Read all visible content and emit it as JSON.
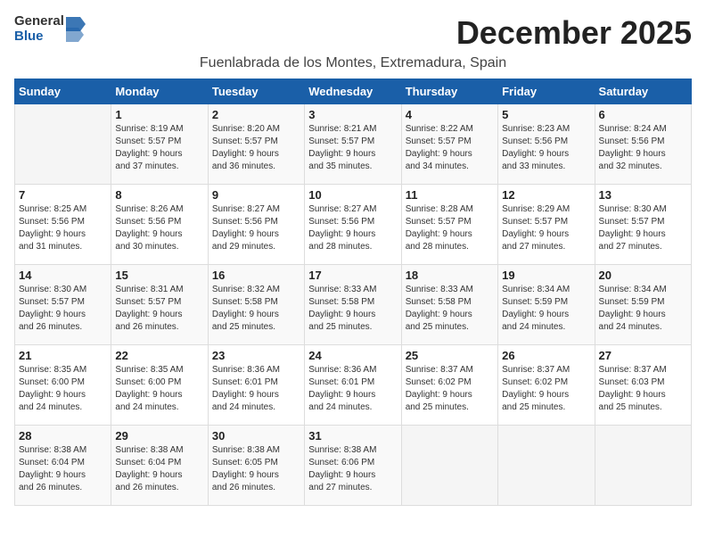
{
  "header": {
    "logo_general": "General",
    "logo_blue": "Blue",
    "month": "December 2025",
    "location": "Fuenlabrada de los Montes, Extremadura, Spain"
  },
  "weekdays": [
    "Sunday",
    "Monday",
    "Tuesday",
    "Wednesday",
    "Thursday",
    "Friday",
    "Saturday"
  ],
  "weeks": [
    [
      {
        "day": "",
        "info": ""
      },
      {
        "day": "1",
        "info": "Sunrise: 8:19 AM\nSunset: 5:57 PM\nDaylight: 9 hours\nand 37 minutes."
      },
      {
        "day": "2",
        "info": "Sunrise: 8:20 AM\nSunset: 5:57 PM\nDaylight: 9 hours\nand 36 minutes."
      },
      {
        "day": "3",
        "info": "Sunrise: 8:21 AM\nSunset: 5:57 PM\nDaylight: 9 hours\nand 35 minutes."
      },
      {
        "day": "4",
        "info": "Sunrise: 8:22 AM\nSunset: 5:57 PM\nDaylight: 9 hours\nand 34 minutes."
      },
      {
        "day": "5",
        "info": "Sunrise: 8:23 AM\nSunset: 5:56 PM\nDaylight: 9 hours\nand 33 minutes."
      },
      {
        "day": "6",
        "info": "Sunrise: 8:24 AM\nSunset: 5:56 PM\nDaylight: 9 hours\nand 32 minutes."
      }
    ],
    [
      {
        "day": "7",
        "info": "Sunrise: 8:25 AM\nSunset: 5:56 PM\nDaylight: 9 hours\nand 31 minutes."
      },
      {
        "day": "8",
        "info": "Sunrise: 8:26 AM\nSunset: 5:56 PM\nDaylight: 9 hours\nand 30 minutes."
      },
      {
        "day": "9",
        "info": "Sunrise: 8:27 AM\nSunset: 5:56 PM\nDaylight: 9 hours\nand 29 minutes."
      },
      {
        "day": "10",
        "info": "Sunrise: 8:27 AM\nSunset: 5:56 PM\nDaylight: 9 hours\nand 28 minutes."
      },
      {
        "day": "11",
        "info": "Sunrise: 8:28 AM\nSunset: 5:57 PM\nDaylight: 9 hours\nand 28 minutes."
      },
      {
        "day": "12",
        "info": "Sunrise: 8:29 AM\nSunset: 5:57 PM\nDaylight: 9 hours\nand 27 minutes."
      },
      {
        "day": "13",
        "info": "Sunrise: 8:30 AM\nSunset: 5:57 PM\nDaylight: 9 hours\nand 27 minutes."
      }
    ],
    [
      {
        "day": "14",
        "info": "Sunrise: 8:30 AM\nSunset: 5:57 PM\nDaylight: 9 hours\nand 26 minutes."
      },
      {
        "day": "15",
        "info": "Sunrise: 8:31 AM\nSunset: 5:57 PM\nDaylight: 9 hours\nand 26 minutes."
      },
      {
        "day": "16",
        "info": "Sunrise: 8:32 AM\nSunset: 5:58 PM\nDaylight: 9 hours\nand 25 minutes."
      },
      {
        "day": "17",
        "info": "Sunrise: 8:33 AM\nSunset: 5:58 PM\nDaylight: 9 hours\nand 25 minutes."
      },
      {
        "day": "18",
        "info": "Sunrise: 8:33 AM\nSunset: 5:58 PM\nDaylight: 9 hours\nand 25 minutes."
      },
      {
        "day": "19",
        "info": "Sunrise: 8:34 AM\nSunset: 5:59 PM\nDaylight: 9 hours\nand 24 minutes."
      },
      {
        "day": "20",
        "info": "Sunrise: 8:34 AM\nSunset: 5:59 PM\nDaylight: 9 hours\nand 24 minutes."
      }
    ],
    [
      {
        "day": "21",
        "info": "Sunrise: 8:35 AM\nSunset: 6:00 PM\nDaylight: 9 hours\nand 24 minutes."
      },
      {
        "day": "22",
        "info": "Sunrise: 8:35 AM\nSunset: 6:00 PM\nDaylight: 9 hours\nand 24 minutes."
      },
      {
        "day": "23",
        "info": "Sunrise: 8:36 AM\nSunset: 6:01 PM\nDaylight: 9 hours\nand 24 minutes."
      },
      {
        "day": "24",
        "info": "Sunrise: 8:36 AM\nSunset: 6:01 PM\nDaylight: 9 hours\nand 24 minutes."
      },
      {
        "day": "25",
        "info": "Sunrise: 8:37 AM\nSunset: 6:02 PM\nDaylight: 9 hours\nand 25 minutes."
      },
      {
        "day": "26",
        "info": "Sunrise: 8:37 AM\nSunset: 6:02 PM\nDaylight: 9 hours\nand 25 minutes."
      },
      {
        "day": "27",
        "info": "Sunrise: 8:37 AM\nSunset: 6:03 PM\nDaylight: 9 hours\nand 25 minutes."
      }
    ],
    [
      {
        "day": "28",
        "info": "Sunrise: 8:38 AM\nSunset: 6:04 PM\nDaylight: 9 hours\nand 26 minutes."
      },
      {
        "day": "29",
        "info": "Sunrise: 8:38 AM\nSunset: 6:04 PM\nDaylight: 9 hours\nand 26 minutes."
      },
      {
        "day": "30",
        "info": "Sunrise: 8:38 AM\nSunset: 6:05 PM\nDaylight: 9 hours\nand 26 minutes."
      },
      {
        "day": "31",
        "info": "Sunrise: 8:38 AM\nSunset: 6:06 PM\nDaylight: 9 hours\nand 27 minutes."
      },
      {
        "day": "",
        "info": ""
      },
      {
        "day": "",
        "info": ""
      },
      {
        "day": "",
        "info": ""
      }
    ]
  ]
}
